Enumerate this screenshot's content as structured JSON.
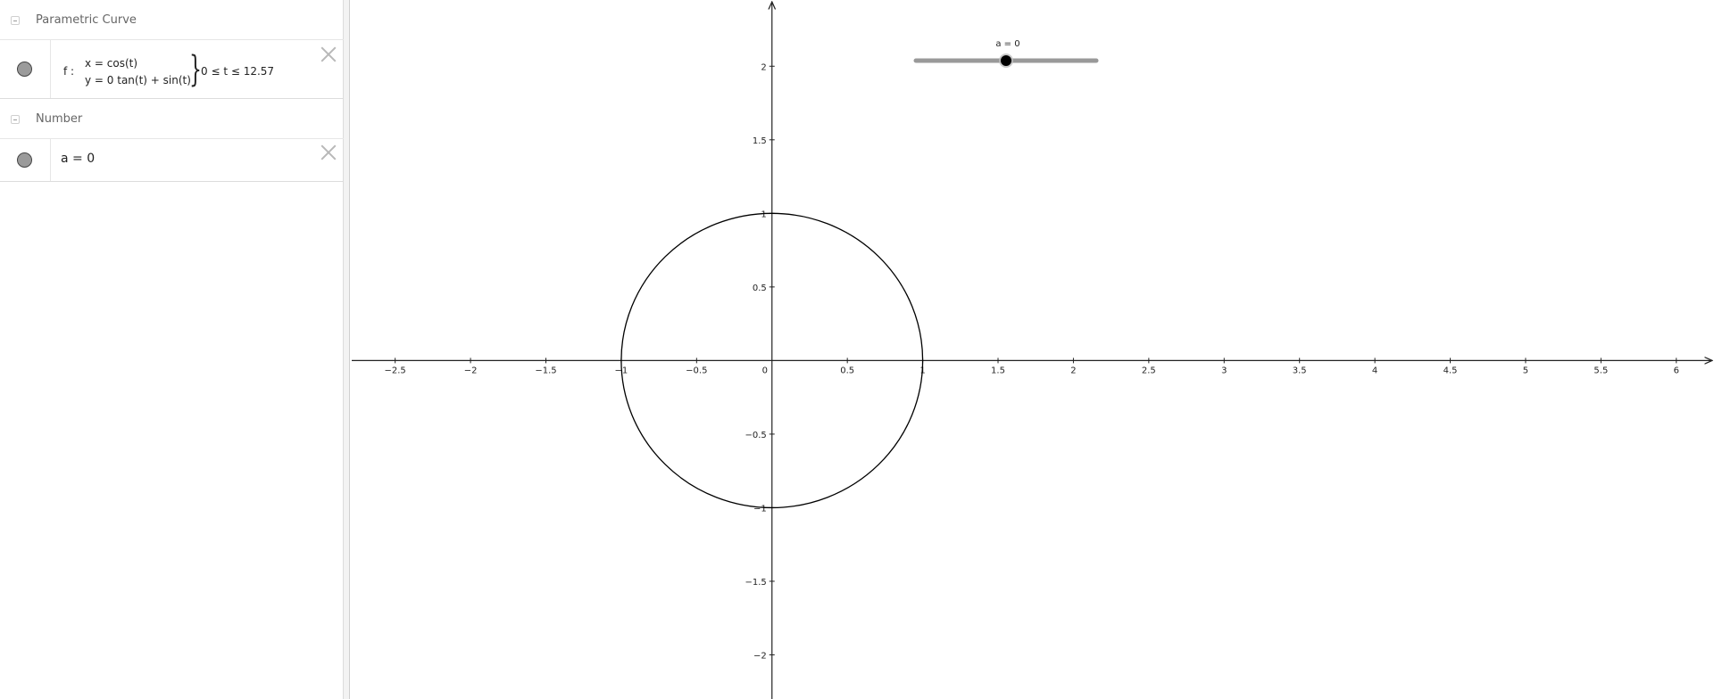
{
  "algebra": {
    "groups": [
      {
        "title": "Parametric Curve",
        "item": {
          "name_label": "f :",
          "x_equation": "x = cos(t)",
          "y_equation": "y = 0  tan(t) + sin(t)",
          "range": "0 ≤ t ≤ 12.57",
          "marble_color": "#9b9b9b"
        }
      },
      {
        "title": "Number",
        "item": {
          "definition": "a = 0",
          "marble_color": "#9b9b9b"
        }
      }
    ]
  },
  "graphics": {
    "axes": {
      "x_ticks": [
        "−2.5",
        "−2",
        "−1.5",
        "−1",
        "−0.5",
        "0",
        "0.5",
        "1",
        "1.5",
        "2",
        "2.5",
        "3",
        "3.5",
        "4",
        "4.5",
        "5",
        "5.5",
        "6"
      ],
      "y_ticks": [
        "2",
        "1.5",
        "1",
        "0.5",
        "−0.5",
        "−1",
        "−1.5",
        "−2"
      ],
      "x_range": [
        -2.8,
        6.25
      ],
      "y_range": [
        -2.3,
        2.45
      ]
    },
    "slider": {
      "label": "a = 0",
      "min": -5,
      "max": 5,
      "value": 0,
      "track_color": "#999999",
      "knob_color": "#000000"
    },
    "curve": {
      "type": "unit-circle",
      "center": [
        0,
        0
      ],
      "radius": 1,
      "color": "#000000"
    }
  }
}
